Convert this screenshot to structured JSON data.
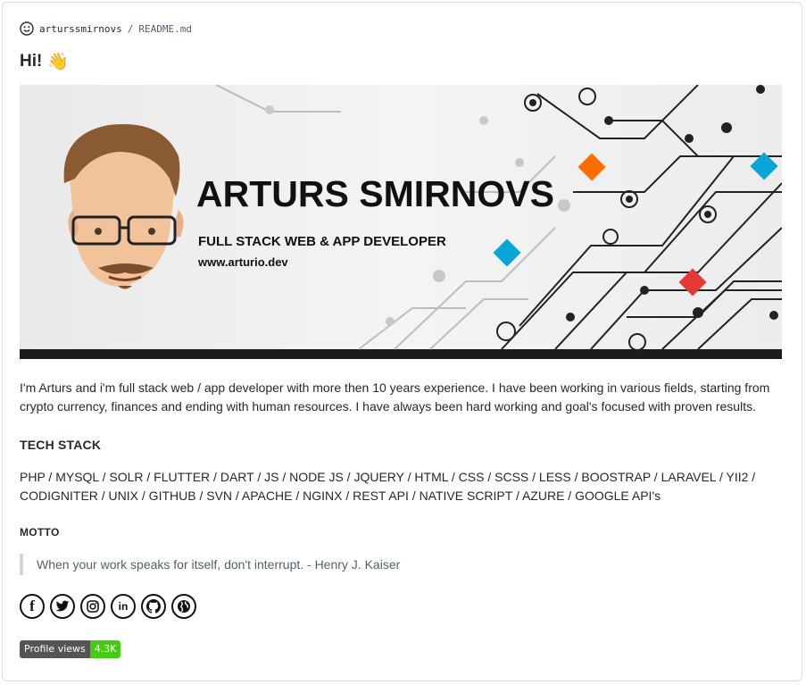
{
  "header": {
    "user": "arturssmirnovs",
    "separator": "/",
    "file": "README.md"
  },
  "readme": {
    "title": "Hi!",
    "title_emoji": "👋",
    "banner": {
      "name": "ARTURS SMIRNOVS",
      "role": "FULL STACK WEB & APP DEVELOPER",
      "site": "www.arturio.dev"
    },
    "intro": "I'm Arturs and i'm full stack web / app developer with more then 10 years experience. I have been working in various fields, starting from crypto currency, finances and ending with human resources. I have always been hard working and goal's focused with proven results.",
    "tech_heading": "TECH STACK",
    "tech_stack": "PHP / MYSQL / SOLR / FLUTTER / DART / JS / NODE JS / JQUERY / HTML / CSS / SCSS / LESS / BOOSTRAP / LARAVEL / YII2 / CODIGNITER / UNIX / GITHUB / SVN / APACHE / NGINX / REST API / NATIVE SCRIPT / AZURE / GOOGLE API's",
    "motto_heading": "MOTTO",
    "motto": "When your work speaks for itself, don't interrupt. - Henry J. Kaiser",
    "social": [
      {
        "name": "facebook-icon",
        "glyph": "f"
      },
      {
        "name": "twitter-icon",
        "glyph": "t"
      },
      {
        "name": "instagram-icon",
        "glyph": "◎"
      },
      {
        "name": "linkedin-icon",
        "glyph": "in"
      },
      {
        "name": "github-icon",
        "glyph": "◉"
      },
      {
        "name": "globe-icon",
        "glyph": "◍"
      }
    ],
    "badge": {
      "label": "Profile views",
      "value": "4.3K",
      "color": "#44cc11"
    }
  }
}
